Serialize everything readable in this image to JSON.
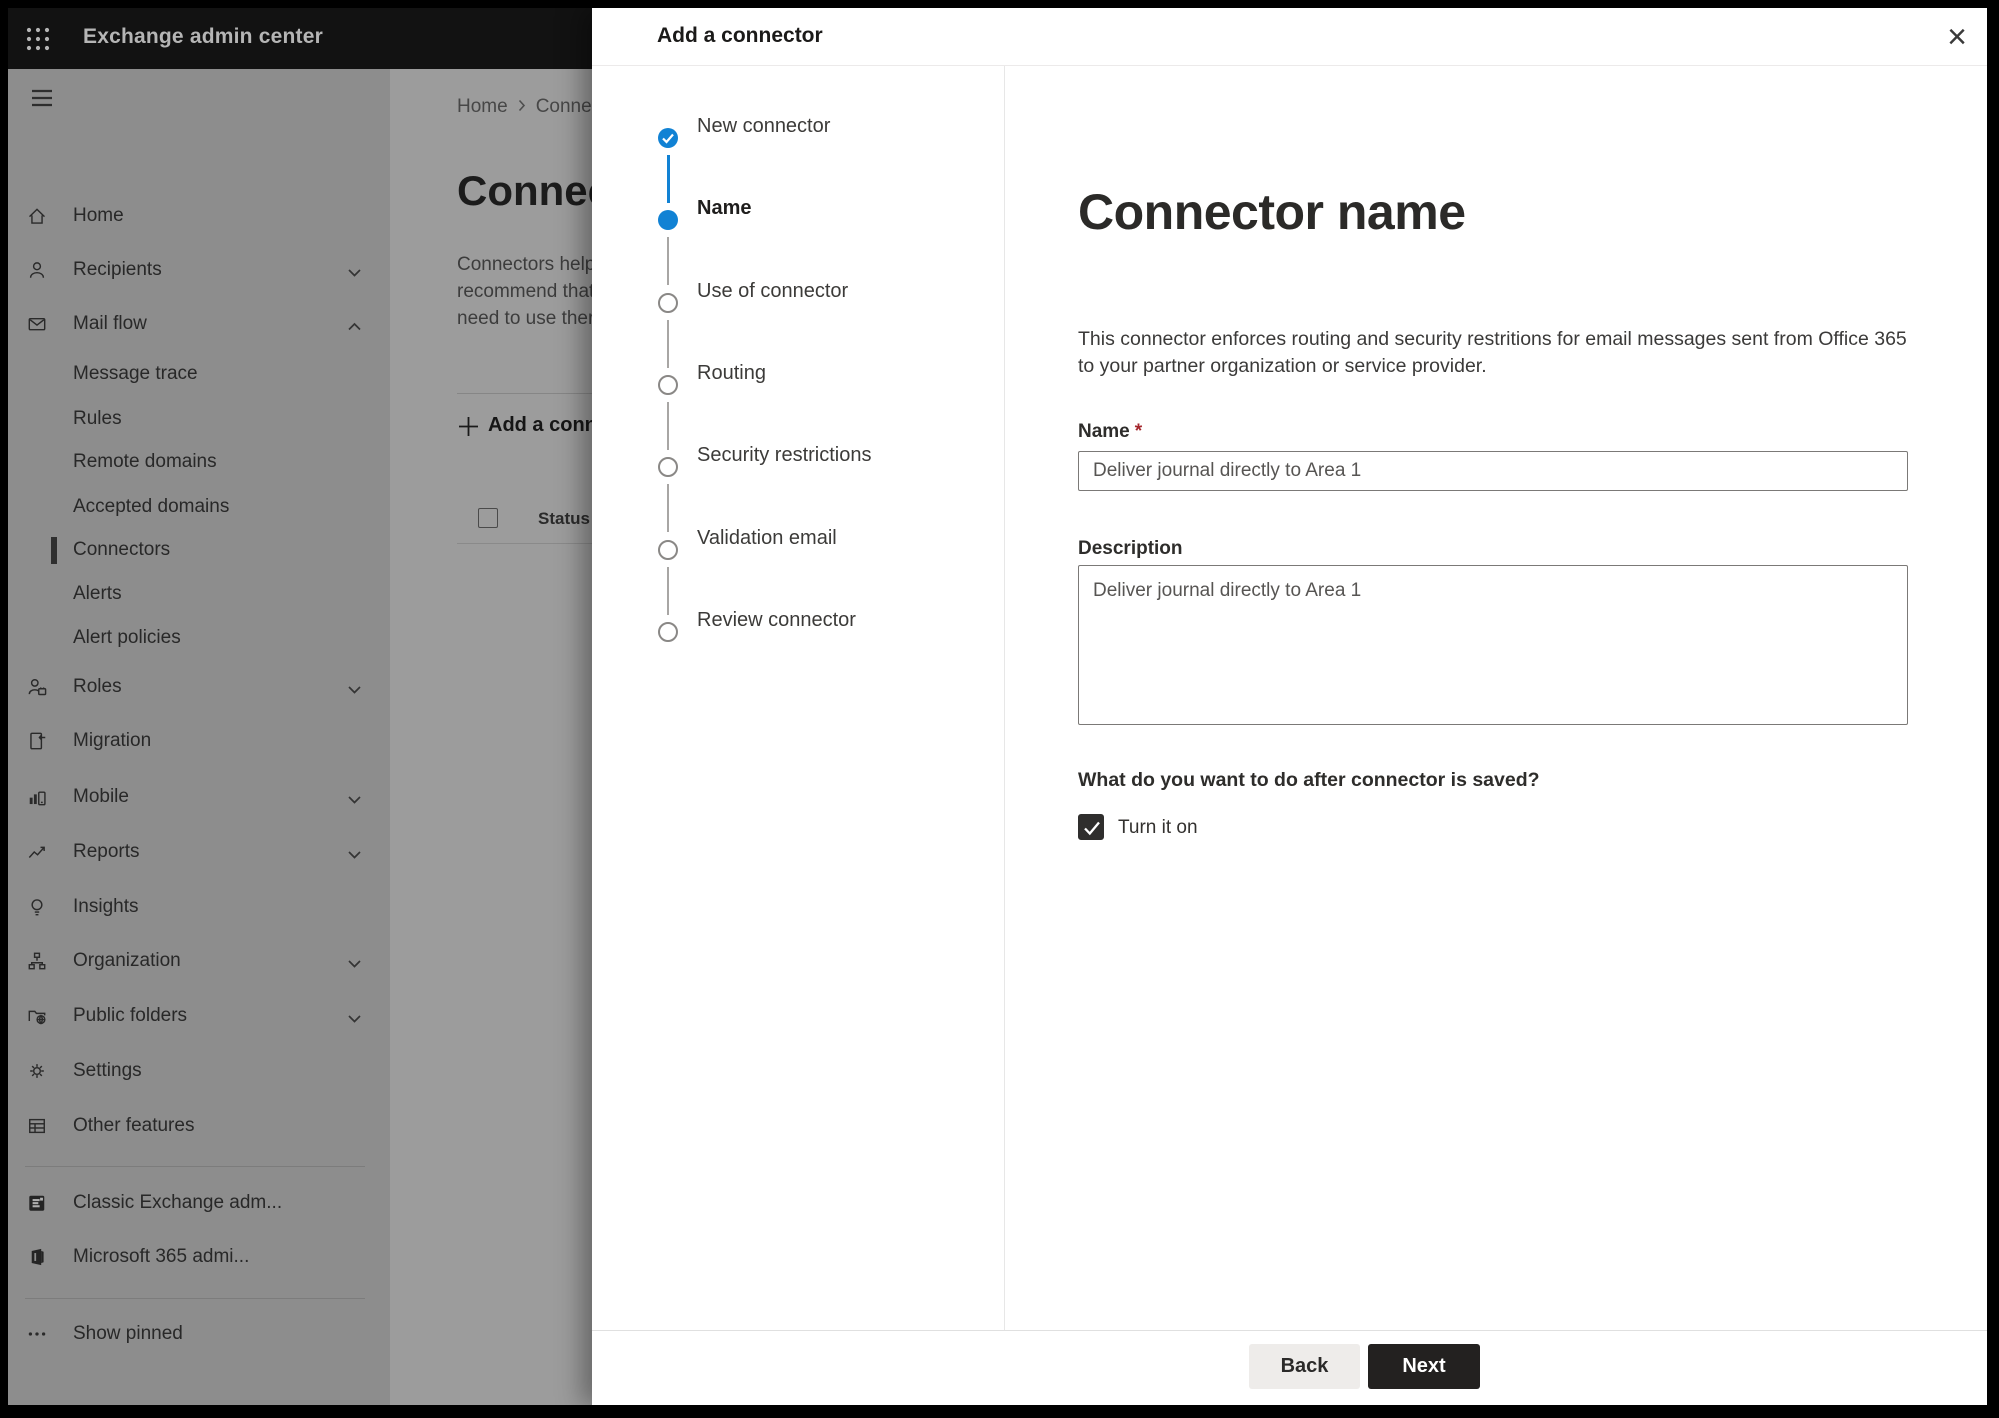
{
  "topbar": {
    "title": "Exchange admin center"
  },
  "sidebar": {
    "items": [
      {
        "label": "Home"
      },
      {
        "label": "Recipients"
      },
      {
        "label": "Mail flow"
      },
      {
        "label": "Message trace"
      },
      {
        "label": "Rules"
      },
      {
        "label": "Remote domains"
      },
      {
        "label": "Accepted domains"
      },
      {
        "label": "Connectors"
      },
      {
        "label": "Alerts"
      },
      {
        "label": "Alert policies"
      },
      {
        "label": "Roles"
      },
      {
        "label": "Migration"
      },
      {
        "label": "Mobile"
      },
      {
        "label": "Reports"
      },
      {
        "label": "Insights"
      },
      {
        "label": "Organization"
      },
      {
        "label": "Public folders"
      },
      {
        "label": "Settings"
      },
      {
        "label": "Other features"
      },
      {
        "label": "Classic Exchange adm..."
      },
      {
        "label": "Microsoft 365 admi..."
      },
      {
        "label": "Show pinned"
      }
    ]
  },
  "background_page": {
    "breadcrumb": {
      "home": "Home",
      "current": "Conne"
    },
    "title": "Connec",
    "paragraph_lines": [
      "Connectors help",
      "recommend that",
      "need to use ther"
    ],
    "add_button_label": "Add a conn",
    "table": {
      "status_header": "Status"
    }
  },
  "modal": {
    "title": "Add a connector",
    "close_glyph": "×",
    "steps": [
      {
        "label": "New connector",
        "state": "completed"
      },
      {
        "label": "Name",
        "state": "current"
      },
      {
        "label": "Use of connector",
        "state": "upcoming"
      },
      {
        "label": "Routing",
        "state": "upcoming"
      },
      {
        "label": "Security restrictions",
        "state": "upcoming"
      },
      {
        "label": "Validation email",
        "state": "upcoming"
      },
      {
        "label": "Review connector",
        "state": "upcoming"
      }
    ],
    "content": {
      "heading": "Connector name",
      "description": "This connector enforces routing and security restritions for email messages sent from Office 365 to your partner organization or service provider.",
      "name_label": "Name",
      "required_mark": "*",
      "name_value": "Deliver journal directly to Area 1",
      "description_label": "Description",
      "description_value": "Deliver journal directly to Area 1",
      "question": "What do you want to do after connector is saved?",
      "checkbox_label": "Turn it on",
      "checkbox_checked": true
    },
    "footer": {
      "back_label": "Back",
      "next_label": "Next"
    }
  },
  "colors": {
    "accent_blue": "#1182d4",
    "required_red": "#a4262c",
    "next_button_bg": "#232120",
    "checkbox_bg": "#2f2e2d",
    "modal_bg": "#ffffff",
    "dim_sidebar_bg": "#8d8d8d",
    "dim_main_bg": "#9c9c9c",
    "topbar_bg": "#121212"
  }
}
